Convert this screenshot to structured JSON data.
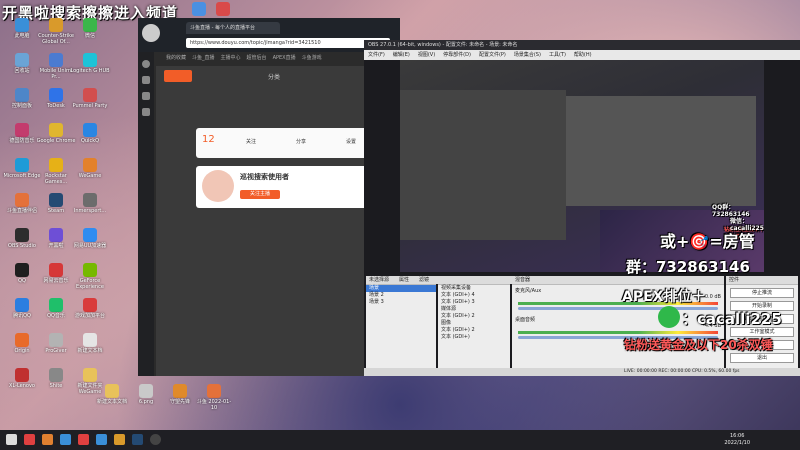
{
  "stream_title": "开黑啦搜索擦擦进入频道",
  "desktop_icons": [
    {
      "label": "此电脑",
      "color": "#3a8fd8",
      "col": 0,
      "row": 0
    },
    {
      "label": "Counter-Strike Global Of...",
      "color": "#d99a2b",
      "col": 1,
      "row": 0
    },
    {
      "label": "微信",
      "color": "#3bb64a",
      "col": 2,
      "row": 0
    },
    {
      "label": "回收站",
      "color": "#6aa4d6",
      "col": 0,
      "row": 1
    },
    {
      "label": "Mobile Unimi Pr...",
      "color": "#4b7bd1",
      "col": 1,
      "row": 1
    },
    {
      "label": "Logitech G HUB",
      "color": "#1ec3d8",
      "col": 2,
      "row": 1
    },
    {
      "label": "控制面板",
      "color": "#4e86c8",
      "col": 0,
      "row": 2
    },
    {
      "label": "ToDesk",
      "color": "#2f73e8",
      "col": 1,
      "row": 2
    },
    {
      "label": "Pummel Party",
      "color": "#d24e4e",
      "col": 2,
      "row": 2
    },
    {
      "label": "德国防音乐",
      "color": "#c33b6d",
      "col": 0,
      "row": 3
    },
    {
      "label": "Google Chrome",
      "color": "#e0b62e",
      "col": 1,
      "row": 3
    },
    {
      "label": "QuickQ",
      "color": "#2a86e3",
      "col": 2,
      "row": 3
    },
    {
      "label": "Microsoft Edge",
      "color": "#1e9bd7",
      "col": 0,
      "row": 4
    },
    {
      "label": "Rockstar Games...",
      "color": "#e6b117",
      "col": 1,
      "row": 4
    },
    {
      "label": "WeGame",
      "color": "#e3812b",
      "col": 2,
      "row": 4
    },
    {
      "label": "斗鱼直播伴侣",
      "color": "#e4713a",
      "col": 0,
      "row": 5
    },
    {
      "label": "Steam",
      "color": "#244a73",
      "col": 1,
      "row": 5
    },
    {
      "label": "Inmerspert...",
      "color": "#6c6c6c",
      "col": 2,
      "row": 5
    },
    {
      "label": "OBS Studio",
      "color": "#2d2d2d",
      "col": 0,
      "row": 6
    },
    {
      "label": "开黑啦",
      "color": "#6e4fd6",
      "col": 1,
      "row": 6
    },
    {
      "label": "网易UU加速器",
      "color": "#2f8cf0",
      "col": 2,
      "row": 6
    },
    {
      "label": "QQ",
      "color": "#1f1f1f",
      "col": 0,
      "row": 7
    },
    {
      "label": "网易云音乐",
      "color": "#d63838",
      "col": 1,
      "row": 7
    },
    {
      "label": "GeForce Experience",
      "color": "#76b900",
      "col": 2,
      "row": 7
    },
    {
      "label": "腾讯QQ",
      "color": "#2b7ee0",
      "col": 0,
      "row": 8
    },
    {
      "label": "QQ音乐",
      "color": "#1fbf6a",
      "col": 1,
      "row": 8
    },
    {
      "label": "游戏加加平台",
      "color": "#d93b3b",
      "col": 2,
      "row": 8
    },
    {
      "label": "Origin",
      "color": "#e86a2a",
      "col": 0,
      "row": 9
    },
    {
      "label": "ProGiver",
      "color": "#b3b3b3",
      "col": 1,
      "row": 9
    },
    {
      "label": "新建文本档",
      "color": "#e5e5e5",
      "col": 2,
      "row": 9
    },
    {
      "label": "XL-Lenovo",
      "color": "#c03030",
      "col": 0,
      "row": 10
    },
    {
      "label": "Shite",
      "color": "#888888",
      "col": 1,
      "row": 10
    },
    {
      "label": "新建文件夹 WeGame",
      "color": "#e8c25a",
      "col": 2,
      "row": 10
    }
  ],
  "desktop_icons_bottom": [
    {
      "label": "新建文本文档",
      "color": "#e8c25a"
    },
    {
      "label": "6.png",
      "color": "#c9c9c9"
    },
    {
      "label": "守望先锋",
      "color": "#e08a2a"
    },
    {
      "label": "斗鱼 2022-01-10",
      "color": "#e4713a"
    }
  ],
  "browser": {
    "tab_label": "斗鱼直播 - 每个人的直播平台",
    "url": "https://www.douyu.com/topic/jlmanga?rid=3421510",
    "bookmarks": [
      "我的收藏",
      "斗鱼_直播",
      "主播中心",
      "超管后台",
      "APEX直播",
      "斗鱼游戏"
    ],
    "header_category": "分类",
    "follow_count": "12",
    "room_badge": "关注主播",
    "streamer_name": "巡视搜索使用者",
    "stats": [
      "关注",
      "分享",
      "设置"
    ]
  },
  "obs": {
    "title": "OBS 27.0.1 (64-bit, windows) - 配置文件: 未命名 - 场景: 未命名",
    "menu": [
      "文件(F)",
      "编辑(E)",
      "视图(V)",
      "停靠部件(D)",
      "配置文件(P)",
      "场景集合(S)",
      "工具(T)",
      "帮助(H)"
    ],
    "scenes_header": "场景",
    "scenes": [
      "场景",
      "场景 2",
      "场景 3"
    ],
    "sources_header": "来源",
    "sources": [
      "视频采集设备",
      "文本 (GDI+) 4",
      "文本 (GDI+) 3",
      "媒体源",
      "文本 (GDI+) 2",
      "图像",
      "文本 (GDI+) 2",
      "文本 (GDI+)"
    ],
    "mixer_header": "混音器",
    "mixer_tracks": [
      {
        "name": "麦克风/Aux",
        "level": "0.0 dB"
      },
      {
        "name": "桌面音频",
        "level": "-4.4 dB"
      }
    ],
    "controls_header": "控件",
    "controls": [
      "停止推流",
      "开始录制",
      "启动虚拟摄像机",
      "工作室模式",
      "设置",
      "退出"
    ],
    "status": "LIVE: 00:00:00   REC: 00:00:00   CPU: 0.5%, 60.00 fps",
    "no_source": "未选择源",
    "props": "属性",
    "filters": "滤镜"
  },
  "overlay": {
    "qq_top": "QQ群：732863146",
    "wechat_top": "微信：cacalli225",
    "gift_top": "钻粉送黄金及以下20杀双锤",
    "admin": "或+🎯=房管",
    "qq_main": "群：732863146",
    "apex_line": "APEX排位＋",
    "wechat_main": "：cacalli225",
    "gift_main": "钻粉送黄金及以下20杀双锤"
  },
  "taskbar": {
    "time": "16:06",
    "date": "2022/1/10"
  }
}
